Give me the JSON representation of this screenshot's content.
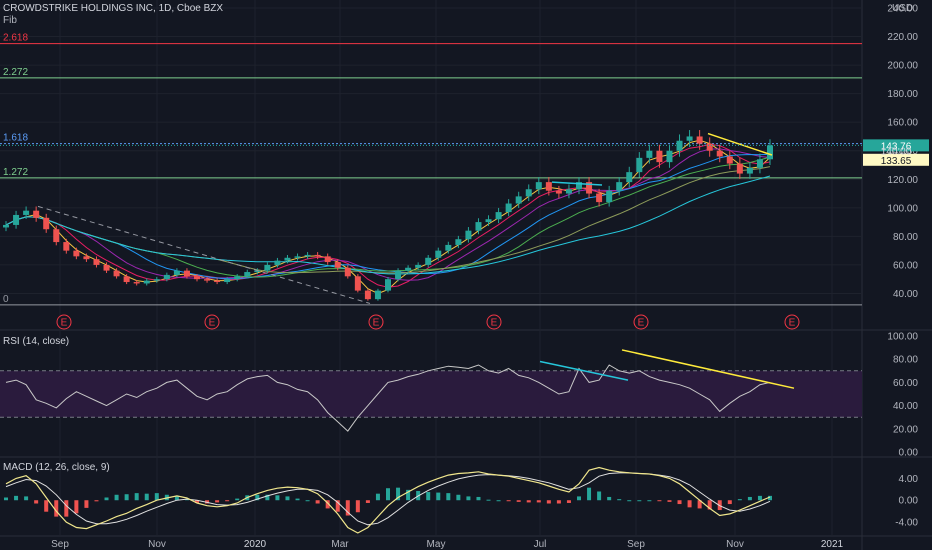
{
  "header": {
    "symbol": "CROWDSTRIKE HOLDINGS INC, 1D, Cboe BZX",
    "currency": "USD",
    "fib_label": "Fib",
    "rsi_label": "RSI (14, close)",
    "macd_label": "MACD (12, 26, close, 9)"
  },
  "colors": {
    "background": "#131722",
    "candle_up": "#26a69a",
    "candle_down": "#ef5350",
    "trendline": "#ffeb3b",
    "rsi_line": "#c8c8c8",
    "rsi_band": "#2a1b3d",
    "macd_line": "#f0e68c",
    "signal_line": "#e0e0e0",
    "last_price": "#26a69a",
    "fib_red": "#f23645",
    "fib_green": "#7fd08f",
    "fib_blue": "#5b9cf6"
  },
  "chart_data": [
    {
      "type": "candlestick",
      "title": "CROWDSTRIKE HOLDINGS INC, 1D, Cboe BZX",
      "x_ticks": [
        "Sep",
        "Nov",
        "2020",
        "Mar",
        "May",
        "Jul",
        "Sep",
        "Nov",
        "2021"
      ],
      "y_ticks": [
        "240.00",
        "220.00",
        "200.00",
        "180.00",
        "160.00",
        "140.00",
        "120.00",
        "100.00",
        "80.00",
        "60.00",
        "40.00"
      ],
      "ylim": [
        20,
        240
      ],
      "last_price": "143.76",
      "price_labels": [
        "140.00",
        "133.65"
      ],
      "fib_levels": [
        {
          "label": "2.618",
          "value": 215,
          "color": "#f23645"
        },
        {
          "label": "2.272",
          "value": 191,
          "color": "#7fd08f"
        },
        {
          "label": "1.618",
          "value": 145,
          "color": "#5b9cf6"
        },
        {
          "label": "1.272",
          "value": 121,
          "color": "#7fd08f"
        },
        {
          "label": "0",
          "value": 32,
          "color": "#9598a1"
        }
      ],
      "earnings_markers": [
        "E",
        "E",
        "E",
        "E",
        "E",
        "E"
      ],
      "weekly_closes": [
        88,
        95,
        98,
        93,
        85,
        76,
        70,
        66,
        64,
        60,
        56,
        52,
        48,
        47,
        49,
        50,
        53,
        56,
        52,
        50,
        49,
        48,
        50,
        52,
        55,
        56,
        60,
        63,
        65,
        66,
        67,
        66,
        62,
        58,
        52,
        42,
        36,
        42,
        50,
        56,
        58,
        60,
        65,
        70,
        74,
        78,
        84,
        90,
        92,
        97,
        103,
        108,
        113,
        118,
        112,
        110,
        113,
        118,
        110,
        104,
        112,
        118,
        125,
        135,
        140,
        132,
        140,
        147,
        150,
        145,
        140,
        136,
        131,
        124,
        128,
        134,
        143.76
      ]
    },
    {
      "type": "line",
      "title": "RSI (14, close)",
      "y_ticks": [
        "100.00",
        "80.00",
        "60.00",
        "40.00",
        "20.00",
        "0.00"
      ],
      "ylim": [
        0,
        100
      ],
      "bands": [
        70,
        30
      ],
      "values": [
        60,
        62,
        58,
        45,
        42,
        38,
        46,
        52,
        48,
        44,
        40,
        45,
        50,
        47,
        52,
        55,
        60,
        62,
        55,
        48,
        45,
        50,
        52,
        58,
        63,
        65,
        66,
        60,
        58,
        54,
        52,
        45,
        34,
        26,
        18,
        30,
        40,
        50,
        60,
        62,
        65,
        67,
        70,
        72,
        74,
        73,
        72,
        75,
        70,
        68,
        72,
        66,
        64,
        60,
        55,
        50,
        52,
        72,
        60,
        62,
        75,
        70,
        68,
        70,
        65,
        62,
        60,
        58,
        55,
        50,
        45,
        35,
        42,
        48,
        52,
        58,
        60
      ]
    },
    {
      "type": "bar",
      "title": "MACD (12, 26, close, 9)",
      "y_ticks": [
        "4.00",
        "0.00",
        "-4.00"
      ],
      "ylim": [
        -6,
        7
      ],
      "macd": [
        3,
        4,
        4.5,
        3,
        0.5,
        -2,
        -4,
        -5,
        -5.2,
        -4.5,
        -3.8,
        -3,
        -2.4,
        -1.5,
        -0.8,
        0,
        0.4,
        0.8,
        0.4,
        -0.5,
        -1,
        -1.2,
        -1,
        -0.5,
        0.5,
        1.2,
        1.8,
        2.2,
        2.4,
        2.3,
        2,
        1.2,
        -0.5,
        -2.5,
        -5,
        -6,
        -5,
        -3,
        -1,
        0.5,
        1.5,
        2.5,
        3.3,
        4,
        4.6,
        4.9,
        5,
        5.2,
        4.8,
        4.6,
        4.4,
        4,
        3.6,
        3.2,
        2.6,
        2,
        1.5,
        3,
        5.5,
        6,
        5.5,
        5.2,
        5,
        4.9,
        4.8,
        4.5,
        4,
        3,
        1.5,
        0,
        -1.5,
        -2.8,
        -2.5,
        -1.8,
        -1,
        -0.2,
        0.6
      ],
      "signal": [
        2.5,
        3.2,
        3.8,
        3.6,
        2.6,
        1,
        -1,
        -2.6,
        -3.8,
        -4.3,
        -4.3,
        -4,
        -3.5,
        -2.8,
        -2,
        -1.3,
        -0.6,
        0,
        0.2,
        0,
        -0.4,
        -0.8,
        -0.9,
        -0.8,
        -0.4,
        0.2,
        0.8,
        1.3,
        1.7,
        2,
        2,
        1.8,
        1,
        -0.4,
        -2.2,
        -3.8,
        -4.5,
        -4.2,
        -3.2,
        -1.8,
        -0.4,
        0.8,
        1.8,
        2.6,
        3.3,
        3.9,
        4.3,
        4.6,
        4.7,
        4.6,
        4.5,
        4.3,
        4,
        3.6,
        3.2,
        2.6,
        2,
        2.3,
        3.2,
        4.4,
        4.9,
        5,
        5,
        4.9,
        4.8,
        4.6,
        4.3,
        3.7,
        2.8,
        1.5,
        0.2,
        -1,
        -1.8,
        -2,
        -1.6,
        -1,
        -0.2
      ]
    }
  ]
}
